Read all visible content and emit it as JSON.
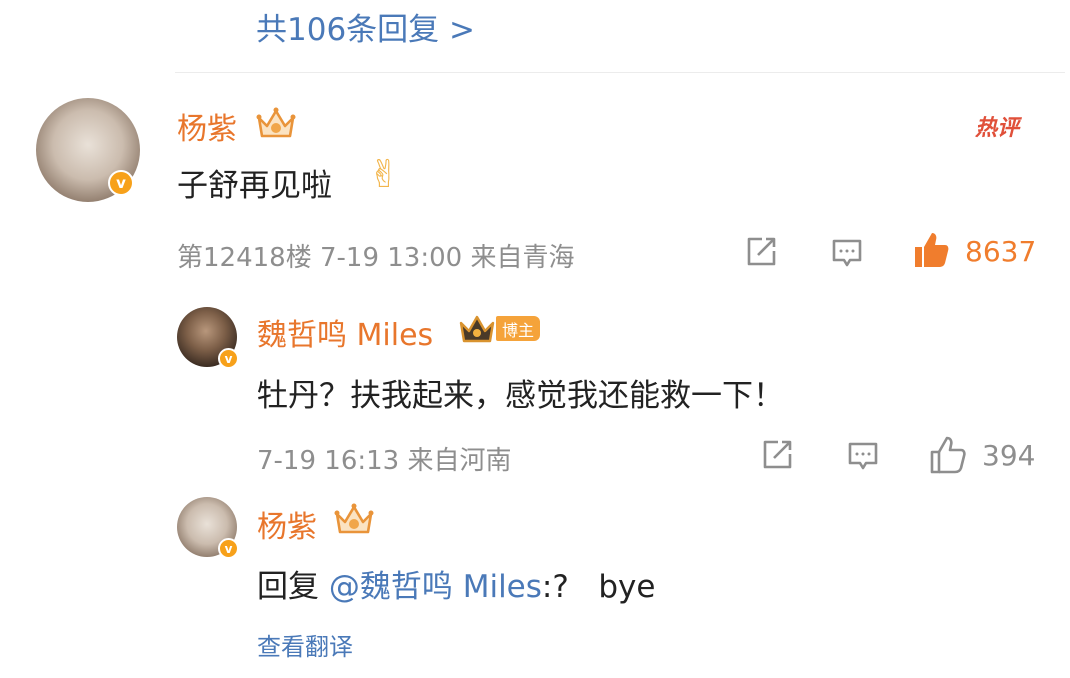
{
  "thread": {
    "more_replies_label": "共106条回复 >"
  },
  "main_comment": {
    "username": "杨紫",
    "text": "子舒再见啦",
    "emoji": "✌",
    "hot_badge": "热评",
    "meta": "第12418楼  7-19 13:00  来自青海",
    "like_count": "8637",
    "liked": true,
    "verified_badge": "v"
  },
  "replies": [
    {
      "username": "魏哲鸣 Miles",
      "role_badge": "博主",
      "text": "牡丹？扶我起来，感觉我还能救一下！",
      "meta": "7-19 16:13  来自河南",
      "like_count": "394",
      "liked": false,
      "verified_badge": "v"
    },
    {
      "username": "杨紫",
      "reply_prefix": "回复 ",
      "mention": "@魏哲鸣 Miles",
      "text_suffix": ":?   bye",
      "translate_label": "查看翻译",
      "verified_badge": "v"
    }
  ],
  "colors": {
    "username": "#e8762c",
    "link": "#4a79b8",
    "meta": "#8e8e8e",
    "liked": "#f07d2d",
    "hot": "#e0503a"
  }
}
